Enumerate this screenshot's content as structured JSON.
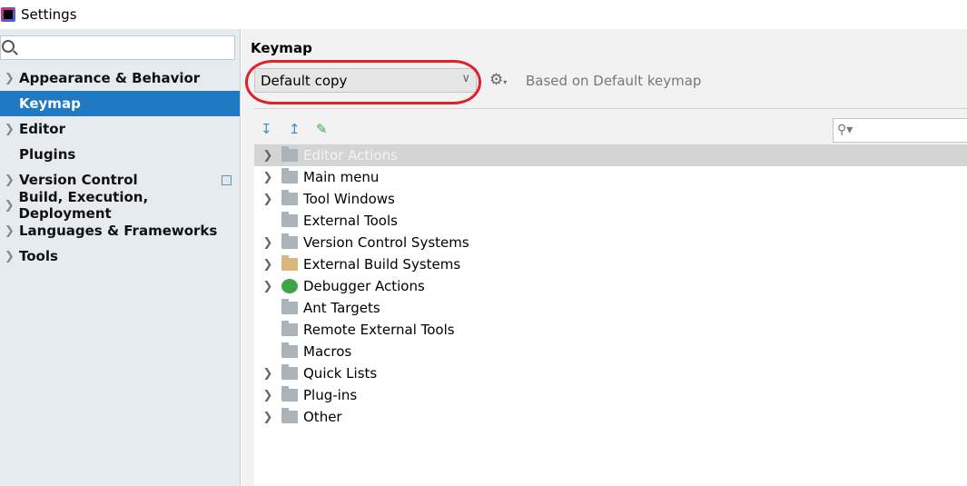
{
  "window": {
    "title": "Settings"
  },
  "sidebar": {
    "search_placeholder": "",
    "items": [
      {
        "label": "Appearance & Behavior",
        "expandable": true
      },
      {
        "label": "Keymap",
        "expandable": false,
        "selected": true
      },
      {
        "label": "Editor",
        "expandable": true
      },
      {
        "label": "Plugins",
        "expandable": false
      },
      {
        "label": "Version Control",
        "expandable": true
      },
      {
        "label": "Build, Execution, Deployment",
        "expandable": true
      },
      {
        "label": "Languages & Frameworks",
        "expandable": true
      },
      {
        "label": "Tools",
        "expandable": true
      }
    ]
  },
  "main": {
    "heading": "Keymap",
    "keymap_select": "Default copy",
    "based_on": "Based on Default keymap",
    "search_value": "",
    "tree": [
      {
        "label": "Editor Actions",
        "expandable": true,
        "icon": "folder-edit-icon",
        "selected": true
      },
      {
        "label": "Main menu",
        "expandable": true,
        "icon": "folder-menu-icon"
      },
      {
        "label": "Tool Windows",
        "expandable": true,
        "icon": "folder-icon"
      },
      {
        "label": "External Tools",
        "expandable": false,
        "icon": "folder-tools-icon"
      },
      {
        "label": "Version Control Systems",
        "expandable": true,
        "icon": "folder-icon"
      },
      {
        "label": "External Build Systems",
        "expandable": true,
        "icon": "folder-build-icon"
      },
      {
        "label": "Debugger Actions",
        "expandable": true,
        "icon": "bug-icon"
      },
      {
        "label": "Ant Targets",
        "expandable": false,
        "icon": "folder-ant-icon"
      },
      {
        "label": "Remote External Tools",
        "expandable": false,
        "icon": "folder-tools-icon"
      },
      {
        "label": "Macros",
        "expandable": false,
        "icon": "folder-icon"
      },
      {
        "label": "Quick Lists",
        "expandable": true,
        "icon": "folder-icon"
      },
      {
        "label": "Plug-ins",
        "expandable": true,
        "icon": "folder-icon"
      },
      {
        "label": "Other",
        "expandable": true,
        "icon": "folder-other-icon"
      }
    ]
  },
  "colors": {
    "selection": "#1f79c3",
    "annotation": "#e0202a"
  }
}
